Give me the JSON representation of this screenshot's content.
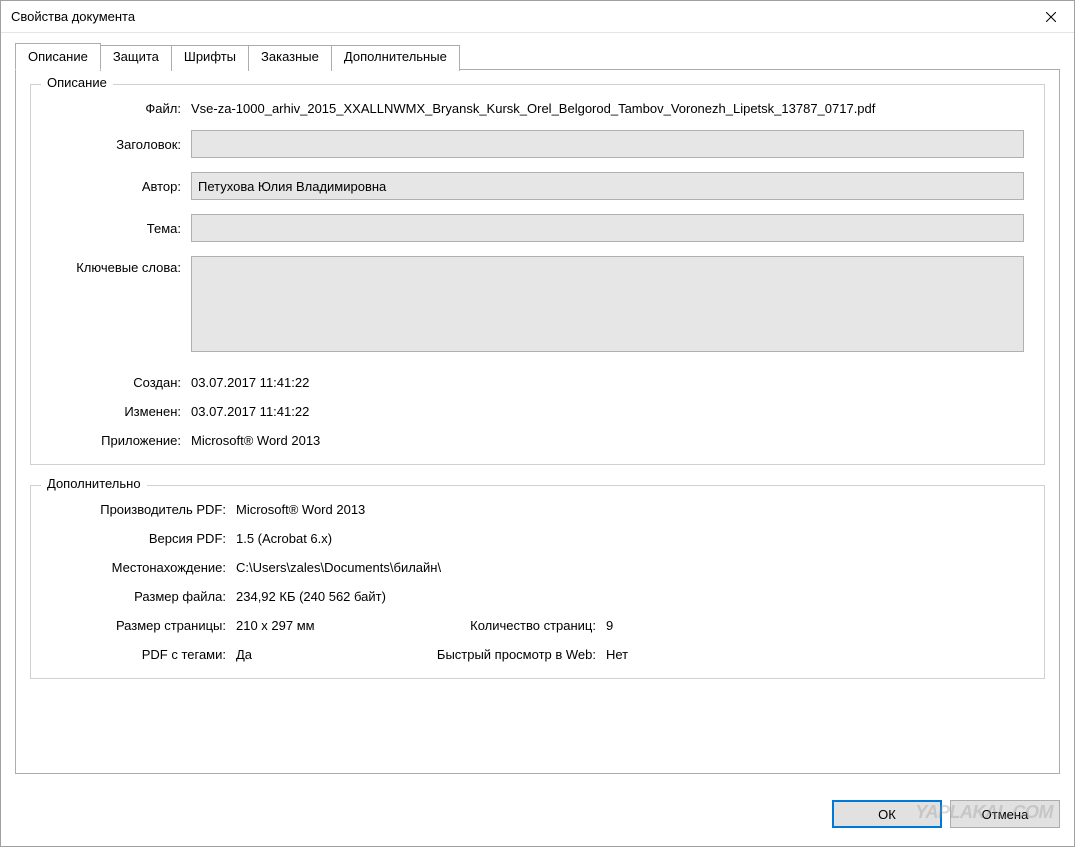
{
  "window": {
    "title": "Свойства документа"
  },
  "tabs": {
    "description": "Описание",
    "security": "Защита",
    "fonts": "Шрифты",
    "custom": "Заказные",
    "additional": "Дополнительные"
  },
  "description_group": {
    "legend": "Описание",
    "file_label": "Файл:",
    "file_value": "Vse-za-1000_arhiv_2015_XXALLNWMX_Bryansk_Kursk_Orel_Belgorod_Tambov_Voronezh_Lipetsk_13787_0717.pdf",
    "title_label": "Заголовок:",
    "title_value": "",
    "author_label": "Автор:",
    "author_value": "Петухова Юлия Владимировна",
    "subject_label": "Тема:",
    "subject_value": "",
    "keywords_label": "Ключевые слова:",
    "keywords_value": "",
    "created_label": "Создан:",
    "created_value": "03.07.2017 11:41:22",
    "modified_label": "Изменен:",
    "modified_value": "03.07.2017 11:41:22",
    "application_label": "Приложение:",
    "application_value": "Microsoft® Word 2013"
  },
  "additional_group": {
    "legend": "Дополнительно",
    "producer_label": "Производитель PDF:",
    "producer_value": "Microsoft® Word 2013",
    "version_label": "Версия PDF:",
    "version_value": "1.5 (Acrobat 6.x)",
    "location_label": "Местонахождение:",
    "location_value": "C:\\Users\\zales\\Documents\\билайн\\",
    "filesize_label": "Размер файла:",
    "filesize_value": "234,92 КБ (240 562 байт)",
    "pagesize_label": "Размер страницы:",
    "pagesize_value": "210 x 297 мм",
    "pagecount_label": "Количество страниц:",
    "pagecount_value": "9",
    "tagged_label": "PDF с тегами:",
    "tagged_value": "Да",
    "webview_label": "Быстрый просмотр в Web:",
    "webview_value": "Нет"
  },
  "buttons": {
    "ok": "ОК",
    "cancel": "Отмена"
  },
  "watermark": "YAPLAKAL.COM"
}
